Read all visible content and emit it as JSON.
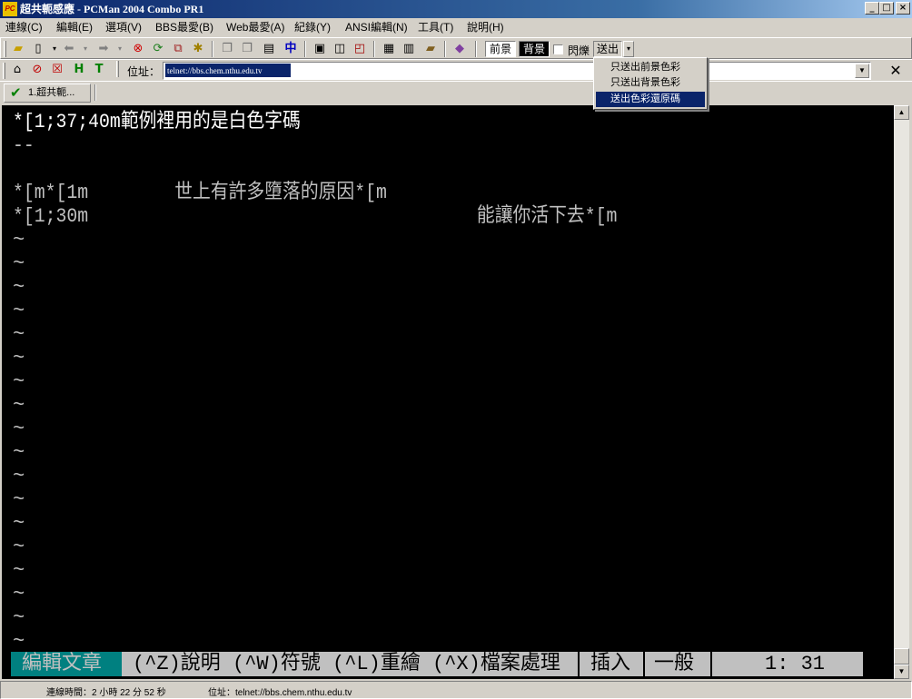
{
  "window": {
    "title": "超共軛感應 - PCMan 2004 Combo PR1",
    "icon_text": "PC",
    "controls": [
      "_",
      "□",
      "×"
    ]
  },
  "menu": [
    "連線(C)",
    "編輯(E)",
    "選項(V)",
    "BBS最愛(B)",
    "Web最愛(A)",
    "紀錄(Y)",
    "ANSI編輯(N)",
    "工具(T)",
    "說明(H)"
  ],
  "toolbar": {
    "fg_label": "前景",
    "bg_label": "背景",
    "blink_label": "閃爍",
    "send_label": "送出"
  },
  "address": {
    "label": "位址：",
    "value": "telnet://bbs.chem.nthu.edu.tv"
  },
  "tab": {
    "label": "1.超共軛..."
  },
  "terminal": {
    "lines": [
      "*[1;37;40m範例裡用的是白色字碼",
      "--",
      "",
      "*[m*[1m        世上有許多墮落的原因*[m",
      "*[1;30m                                    能讓你活下去*[m"
    ],
    "tilde": "~",
    "status": {
      "mode": "編輯文章",
      "help": "(^Z)說明 (^W)符號 (^L)重繪 (^X)檔案處理",
      "insert": "插入",
      "normal": "一般",
      "position": "1: 31"
    }
  },
  "statusbar": {
    "connection": "連線時間：2 小時 22 分 52 秒",
    "address": "位址：telnet://bbs.chem.nthu.edu.tv"
  },
  "dropdown": {
    "items": [
      "只送出前景色彩",
      "只送出背景色彩",
      "送出色彩還原碼"
    ],
    "selected_index": 2
  },
  "colors": {
    "titlebar": "#0a246a",
    "terminal_bg": "#000000",
    "status_mode_bg": "#008080",
    "status_bg": "#c0c0c0"
  }
}
